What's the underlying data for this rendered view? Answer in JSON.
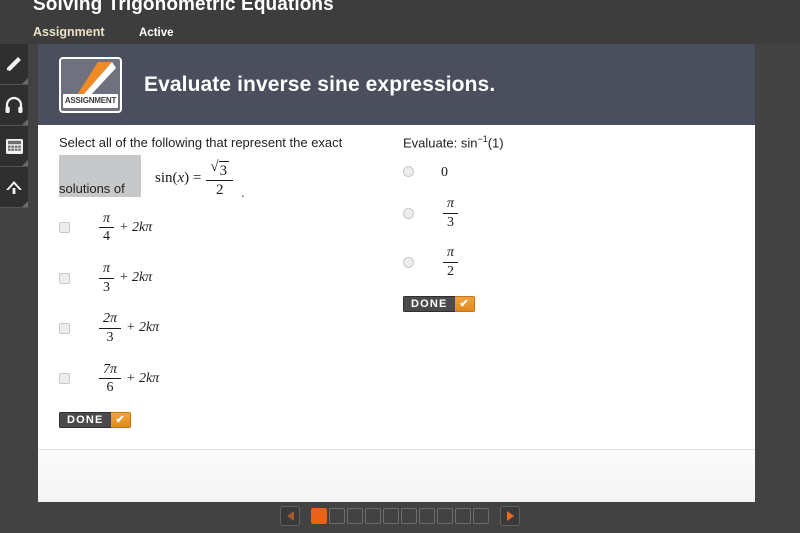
{
  "header": {
    "lesson_title": "Solving Trigonometric Equations",
    "tab_assignment": "Assignment",
    "tab_active": "Active"
  },
  "card": {
    "icon_label": "ASSIGNMENT",
    "title": "Evaluate inverse sine expressions."
  },
  "question_left": {
    "prompt_line1": "Select all of the following that represent the exact",
    "prompt_line2": "solutions of",
    "equation": {
      "lhs": "sin(",
      "lhs_var": "x",
      "lhs_close": ") =",
      "rhs_radical_sign": "√",
      "rhs_numerator": "3",
      "rhs_denominator": "2"
    },
    "period": ".",
    "options": [
      {
        "num": "π",
        "den": "4",
        "tail": "+ 2kπ",
        "checked": false
      },
      {
        "num": "π",
        "den": "3",
        "tail": "+ 2kπ",
        "checked": false
      },
      {
        "num": "2π",
        "den": "3",
        "tail": "+ 2kπ",
        "checked": false
      },
      {
        "num": "7π",
        "den": "6",
        "tail": "+ 2kπ",
        "checked": false
      }
    ],
    "done_label": "DONE",
    "done_tick": "✔"
  },
  "question_right": {
    "prompt": "Evaluate: sin",
    "prompt_exponent": "−1",
    "prompt_arg": "(1)",
    "options": [
      {
        "plain": "0",
        "num": "",
        "den": "",
        "selected": false
      },
      {
        "plain": "",
        "num": "π",
        "den": "3",
        "selected": false
      },
      {
        "plain": "",
        "num": "π",
        "den": "2",
        "selected": false
      }
    ],
    "done_label": "DONE",
    "done_tick": "✔"
  },
  "sidebar": {
    "items": [
      {
        "icon": "highlighter-icon"
      },
      {
        "icon": "headphones-icon"
      },
      {
        "icon": "calculator-icon"
      },
      {
        "icon": "up-arrow-icon"
      }
    ]
  },
  "pagination": {
    "prev_icon": "triangle-left-icon",
    "next_icon": "triangle-right-icon",
    "total_pages": 10,
    "current_page": 1
  },
  "colors": {
    "page_background": "#424242",
    "card_header": "#4b4e5c",
    "accent_orange": "#e8621a",
    "tab_active": "#e8e3c4",
    "highlight_block": "#c6c8ca"
  }
}
